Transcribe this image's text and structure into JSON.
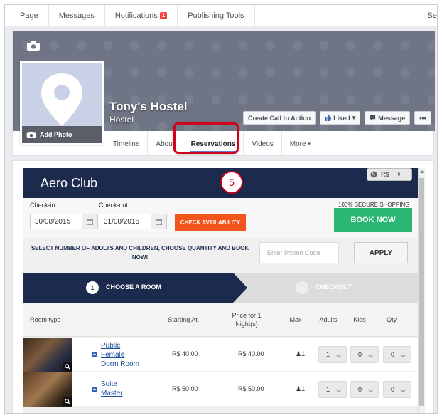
{
  "nav": {
    "items": [
      "Page",
      "Messages",
      "Notifications",
      "Publishing Tools"
    ],
    "notification_count": "1",
    "settings": "Sett"
  },
  "profile": {
    "add_photo": "Add Photo",
    "name": "Tony's Hostel",
    "category": "Hostel"
  },
  "cover_buttons": {
    "cta": "Create Call to Action",
    "liked": "Liked",
    "message": "Message",
    "more": "•••"
  },
  "tabs": [
    "Timeline",
    "About",
    "Reservations",
    "Videos",
    "More"
  ],
  "active_tab": "Reservations",
  "callout_step": "5",
  "booking": {
    "brand": "Aero Club",
    "currency": "R$",
    "checkin_label": "Check-in",
    "checkout_label": "Check-out",
    "checkin": "30/08/2015",
    "checkout": "31/08/2015",
    "check_availability": "CHECK AVAILABILITY",
    "secure": "100% SECURE SHOPPING",
    "book_now": "BOOK NOW",
    "instructions": "SELECT NUMBER OF ADULTS AND CHILDREN, CHOOSE QUANTITY AND BOOK NOW!",
    "promo_placeholder": "Enter Promo Code",
    "apply": "APPLY",
    "steps": [
      {
        "num": "1",
        "label": "CHOOSE A ROOM"
      },
      {
        "num": "2",
        "label": "CHECKOUT"
      }
    ],
    "columns": {
      "room_type": "Room type",
      "starting_at": "Starting At",
      "price_for": "Price for  1 Night(s)",
      "max": "Max",
      "adults": "Adults",
      "kids": "Kids",
      "qty": "Qty."
    },
    "rooms": [
      {
        "name": "Public Female Dorm Room",
        "start": "R$ 40.00",
        "price": "R$ 40.00",
        "max": "1",
        "adults": "1",
        "kids": "0",
        "qty": "0"
      },
      {
        "name": "Suite Master",
        "start": "R$ 50.00",
        "price": "R$ 50.00",
        "max": "1",
        "adults": "1",
        "kids": "0",
        "qty": "0"
      }
    ]
  },
  "colors": {
    "brand_navy": "#1b2a4d",
    "accent_orange": "#f2541b",
    "book_green": "#2bb673",
    "highlight_red": "#d0021b"
  }
}
